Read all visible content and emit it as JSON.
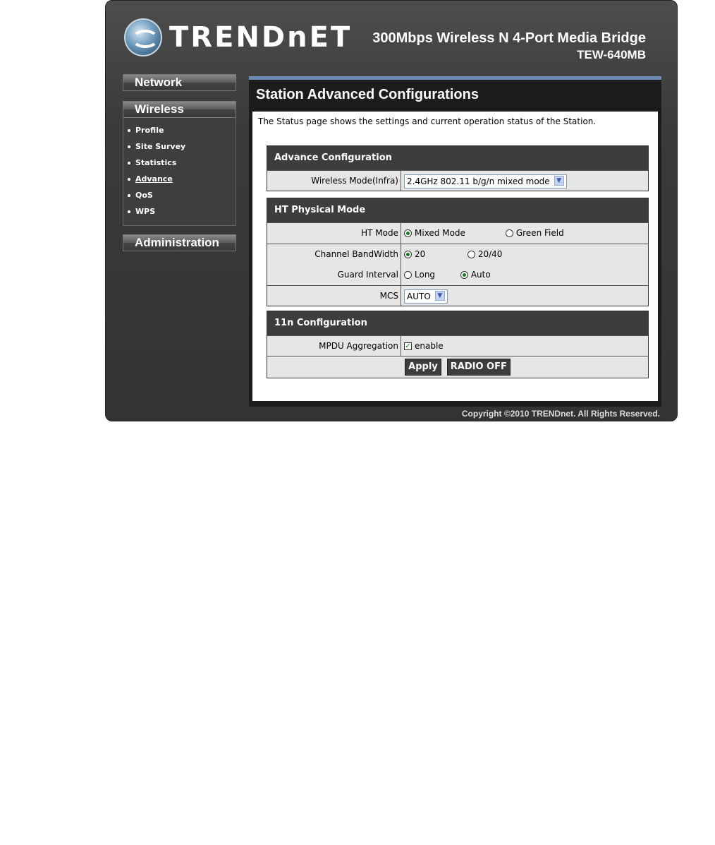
{
  "header": {
    "logo_text": "TRENDnET",
    "product_line": "300Mbps Wireless N 4-Port Media Bridge",
    "model": "TEW-640MB"
  },
  "nav": {
    "network_label": "Network",
    "wireless_label": "Wireless",
    "wireless_items": [
      {
        "label": "Profile"
      },
      {
        "label": "Site Survey"
      },
      {
        "label": "Statistics"
      },
      {
        "label": "Advance"
      },
      {
        "label": "QoS"
      },
      {
        "label": "WPS"
      }
    ],
    "administration_label": "Administration"
  },
  "page": {
    "title": "Station Advanced Configurations",
    "description": "The Status page shows the settings and current operation status of the Station."
  },
  "advance_config": {
    "heading": "Advance Configuration",
    "wireless_mode_label": "Wireless Mode(Infra)",
    "wireless_mode_value": "2.4GHz 802.11 b/g/n mixed mode"
  },
  "ht_physical": {
    "heading": "HT Physical Mode",
    "ht_mode_label": "HT Mode",
    "ht_mode_options": [
      "Mixed Mode",
      "Green Field"
    ],
    "ht_mode_selected": "Mixed Mode",
    "bandwidth_label": "Channel BandWidth",
    "bandwidth_options": [
      "20",
      "20/40"
    ],
    "bandwidth_selected": "20",
    "guard_label": "Guard Interval",
    "guard_options": [
      "Long",
      "Auto"
    ],
    "guard_selected": "Auto",
    "mcs_label": "MCS",
    "mcs_value": "AUTO"
  },
  "n11_config": {
    "heading": "11n Configuration",
    "mpdu_label": "MPDU Aggregation",
    "mpdu_option": "enable",
    "mpdu_checked": true
  },
  "buttons": {
    "apply": "Apply",
    "radio_off": "RADIO OFF"
  },
  "footer": {
    "copyright": "Copyright ©2010 TRENDnet. All Rights Reserved."
  },
  "colors": {
    "frame": "#3a3a3a",
    "accent_bar": "#6b8db5",
    "section_head": "#3d3d3d",
    "row_bg": "#e6e6e6"
  }
}
